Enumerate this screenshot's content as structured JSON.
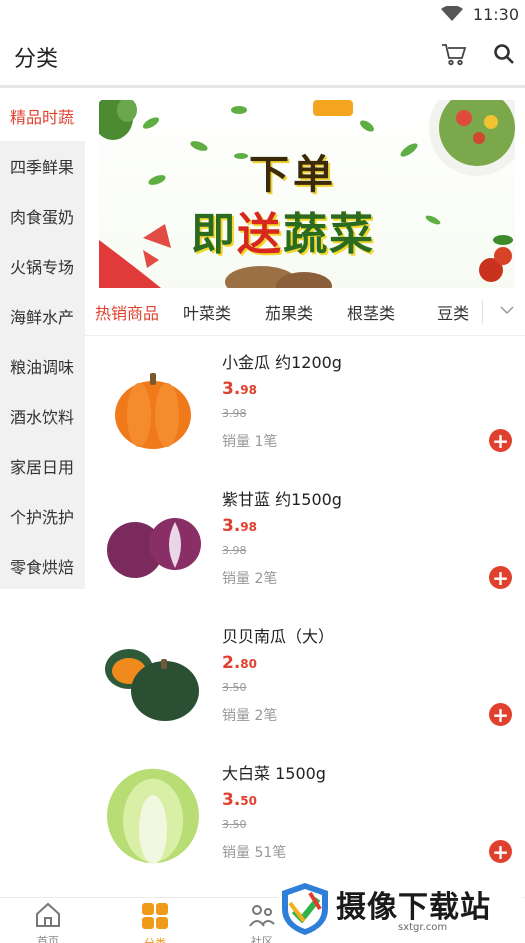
{
  "status_bar": {
    "time": "11:30"
  },
  "header": {
    "title": "分类"
  },
  "sidebar": {
    "items": [
      {
        "label": "精品时蔬",
        "active": true
      },
      {
        "label": "四季鲜果"
      },
      {
        "label": "肉食蛋奶"
      },
      {
        "label": "火锅专场"
      },
      {
        "label": "海鲜水产"
      },
      {
        "label": "粮油调味"
      },
      {
        "label": "酒水饮料"
      },
      {
        "label": "家居日用"
      },
      {
        "label": "个护洗护"
      },
      {
        "label": "零食烘焙"
      }
    ]
  },
  "banner": {
    "line1": "下单",
    "line2_a": "即",
    "line2_accent": "送",
    "line2_b": "蔬菜"
  },
  "tabs": [
    {
      "label": "热销商品",
      "active": true
    },
    {
      "label": "叶菜类"
    },
    {
      "label": "茄果类"
    },
    {
      "label": "根茎类"
    },
    {
      "label": "豆类"
    }
  ],
  "products": [
    {
      "name": "小金瓜 约1200g",
      "price_int": "3.",
      "price_dec": "98",
      "orig": "3.98",
      "sales": "销量 1笔"
    },
    {
      "name": "紫甘蓝 约1500g",
      "price_int": "3.",
      "price_dec": "98",
      "orig": "3.98",
      "sales": "销量 2笔"
    },
    {
      "name": "贝贝南瓜（大）",
      "price_int": "2.",
      "price_dec": "80",
      "orig": "3.50",
      "sales": "销量 2笔"
    },
    {
      "name": "大白菜 1500g",
      "price_int": "3.",
      "price_dec": "50",
      "orig": "3.50",
      "sales": "销量 51笔"
    }
  ],
  "bottom_nav": [
    {
      "label": "首页",
      "icon": "home-icon"
    },
    {
      "label": "分类",
      "icon": "category-icon",
      "active": true
    },
    {
      "label": "社区",
      "icon": "community-icon"
    }
  ],
  "watermark": {
    "brand": "摄像下载站",
    "url": "sxtgr.com"
  },
  "colors": {
    "accent": "#e0412f",
    "nav_active": "#f09a1b"
  }
}
